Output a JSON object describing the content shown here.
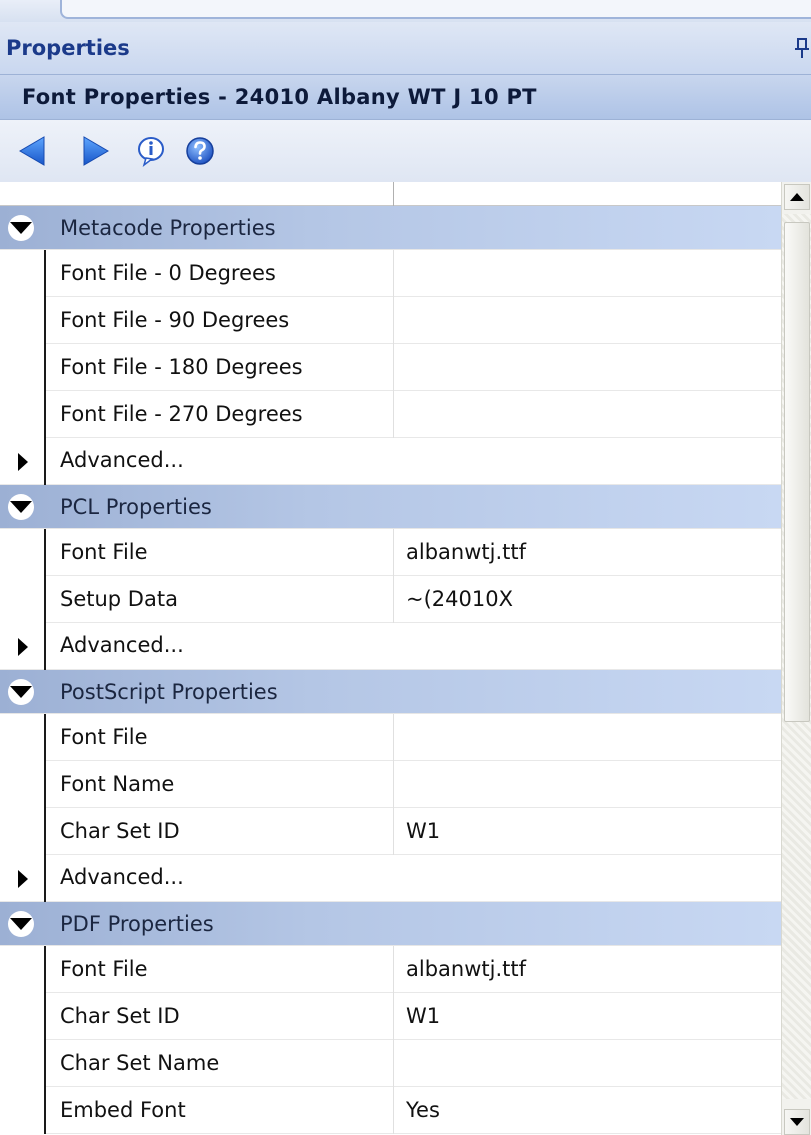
{
  "panel": {
    "title": "Properties",
    "pin_glyph": "⊥"
  },
  "header": {
    "text": "Font Properties - 24010  Albany WT J 10 PT"
  },
  "toolbar": {
    "buttons": [
      {
        "icon": "back-arrow-icon"
      },
      {
        "icon": "forward-arrow-icon"
      },
      {
        "icon": "info-icon"
      },
      {
        "icon": "help-icon"
      }
    ]
  },
  "colors": {
    "category_band": "#9cb0d4",
    "header_text": "#0d1a3a",
    "title_text": "#1b3a8a"
  },
  "sections": [
    {
      "label": "Metacode Properties",
      "rows": [
        {
          "name": "Font File - 0 Degrees",
          "value": ""
        },
        {
          "name": "Font File - 90 Degrees",
          "value": ""
        },
        {
          "name": "Font File - 180 Degrees",
          "value": ""
        },
        {
          "name": "Font File - 270 Degrees",
          "value": ""
        }
      ],
      "advanced": "Advanced..."
    },
    {
      "label": "PCL Properties",
      "rows": [
        {
          "name": "Font File",
          "value": "albanwtj.ttf"
        },
        {
          "name": "Setup Data",
          "value": "~(24010X"
        }
      ],
      "advanced": "Advanced..."
    },
    {
      "label": "PostScript Properties",
      "rows": [
        {
          "name": "Font File",
          "value": ""
        },
        {
          "name": "Font Name",
          "value": ""
        },
        {
          "name": "Char Set ID",
          "value": "W1"
        }
      ],
      "advanced": "Advanced..."
    },
    {
      "label": "PDF Properties",
      "rows": [
        {
          "name": "Font File",
          "value": "albanwtj.ttf"
        },
        {
          "name": "Char Set ID",
          "value": "W1"
        },
        {
          "name": "Char Set Name",
          "value": ""
        },
        {
          "name": "Embed Font",
          "value": "Yes"
        }
      ]
    }
  ]
}
